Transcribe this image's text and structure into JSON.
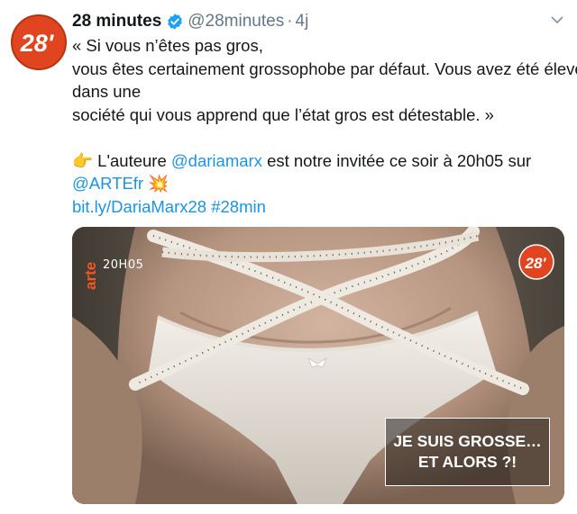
{
  "tweet": {
    "author_name": "28 minutes",
    "handle": "@28minutes",
    "separator": "·",
    "timestamp": "4j",
    "avatar_label": "28'",
    "lines": [
      "« Si vous n’êtes pas gros,",
      "vous êtes certainement grossophobe par défaut. Vous avez été élevé",
      "dans une",
      "société qui vous apprend que l’état gros est détestable. »"
    ],
    "invite": {
      "emoji": "👉",
      "prefix": " L'auteure ",
      "mention1": "@dariamarx",
      "middle": " est notre invitée ce soir à 20h05 sur",
      "mention2": "@ARTEfr",
      "emoji2": "💥",
      "link": "bit.ly/DariaMarx28",
      "hashtag": "#28min"
    }
  },
  "media": {
    "channel_logo_text": "arte",
    "broadcast_time": "20H05",
    "show_logo_text": "28'",
    "caption_line1": "JE SUIS GROSSE…",
    "caption_line2": "ET ALORS ?!"
  },
  "colors": {
    "link": "#1b95e0",
    "verified": "#1da1f2",
    "secondary_text": "#657786",
    "brand_red": "#e0451f",
    "arte_orange": "#f2581f"
  },
  "icons": {
    "verified": "verified-badge-icon",
    "menu": "chevron-down-icon"
  }
}
